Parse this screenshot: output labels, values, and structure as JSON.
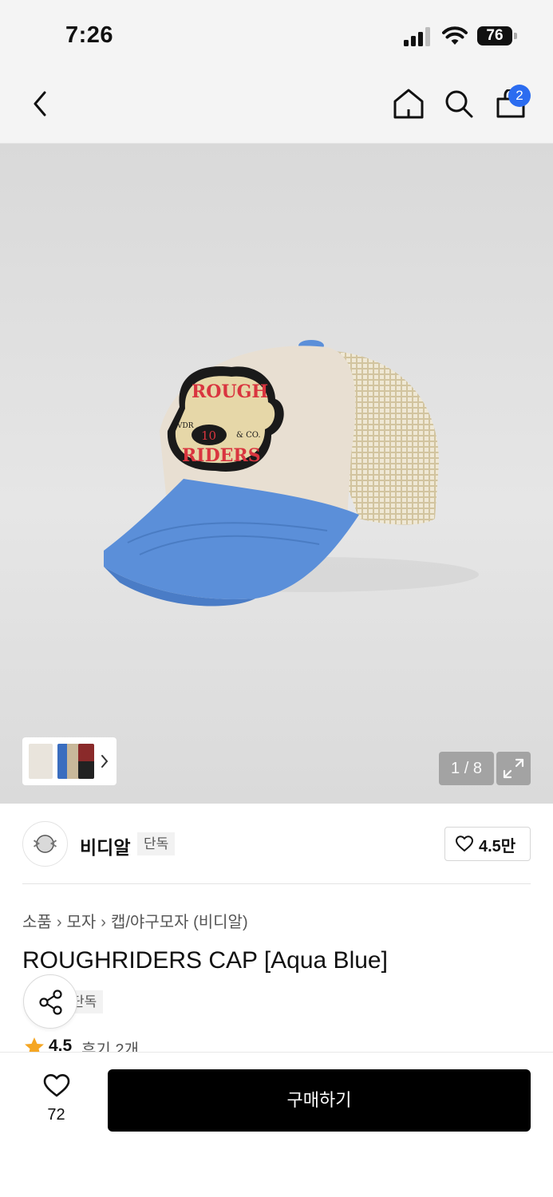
{
  "status_bar": {
    "time": "7:26",
    "battery": "76"
  },
  "nav": {
    "cart_badge": "2",
    "icons": [
      "back-chevron-icon",
      "home-icon",
      "search-icon",
      "shopping-bag-icon"
    ]
  },
  "gallery": {
    "page_indicator": "1 / 8",
    "thumbnail_count": 3,
    "patch_text": [
      "ROUGH",
      "RIDERS",
      "10",
      "VDR",
      "& CO."
    ],
    "colors": {
      "crown": "#e8dfd2",
      "brim": "#5b8fd9",
      "mesh": "#d2c49f",
      "patch_red": "#d9353f"
    }
  },
  "brand": {
    "name": "비디알",
    "tag": "단독",
    "likes": "4.5만"
  },
  "product": {
    "breadcrumb": [
      "소품",
      "모자",
      "캡/야구모자 (비디알)"
    ],
    "title": "ROUGHRIDERS CAP [Aqua Blue]",
    "exclusive_tag": "단독",
    "rating": "4.5",
    "reviews": "후기 2개"
  },
  "bottom": {
    "wish_count": "72",
    "buy_label": "구매하기"
  },
  "colors": {
    "accent_badge": "#2b6cf0",
    "buy_button": "#000000",
    "star": "#f5a623"
  }
}
